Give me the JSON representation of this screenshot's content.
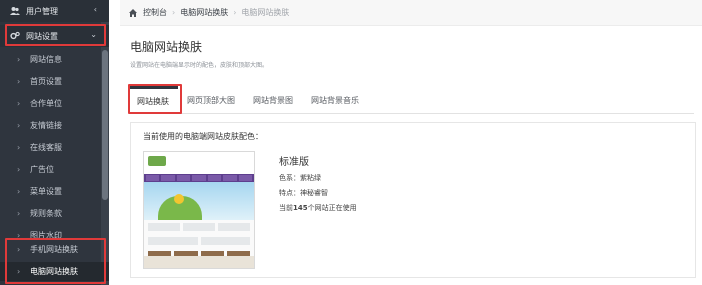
{
  "sidebar": {
    "user_mgmt": "用户管理",
    "site_settings": "网站设置",
    "items": [
      "网站信息",
      "首页设置",
      "合作单位",
      "友情链接",
      "在线客服",
      "广告位",
      "菜单设置",
      "规则条款",
      "图片水印",
      "手机网站换肤",
      "电脑网站换肤"
    ]
  },
  "breadcrumb": {
    "home": "控制台",
    "parent": "电脑网站换肤",
    "current": "电脑网站换肤"
  },
  "page": {
    "title": "电脑网站换肤",
    "desc": "设置网站在电脑端显示时的配色，皮肤和顶部大图。"
  },
  "tabs": [
    "网站换肤",
    "网页顶部大图",
    "网站背景图",
    "网站背景音乐"
  ],
  "panel": {
    "heading": "当前使用的电脑端网站皮肤配色：",
    "theme_name": "标准版",
    "color_label": "色系：紫粘绿",
    "feature_label": "特点：神秘睿智",
    "usage_prefix": "当前",
    "usage_count": "145",
    "usage_suffix": "个网站正在使用"
  },
  "colors": {
    "sidebar_bg": "#2f353e",
    "highlight": "#e03a3a",
    "theme_purple": "#5e3f8e",
    "theme_green": "#6ea84a"
  }
}
